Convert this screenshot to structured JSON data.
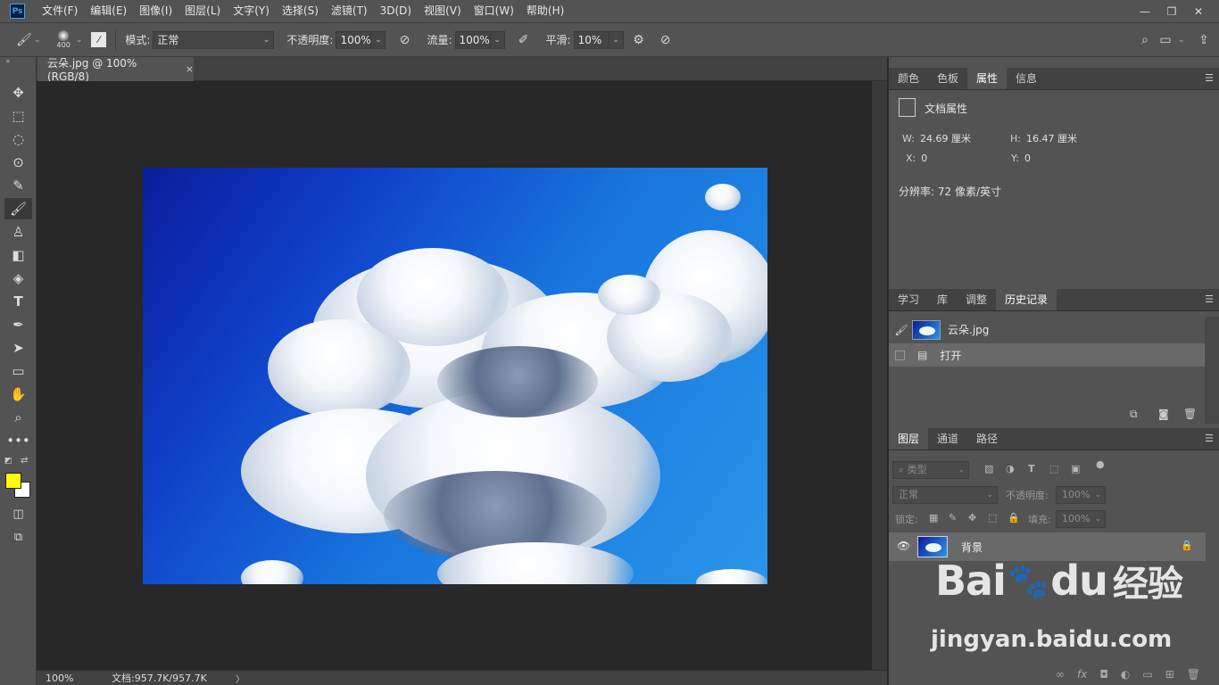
{
  "app": {
    "logo": "Ps"
  },
  "menu": [
    "文件(F)",
    "编辑(E)",
    "图像(I)",
    "图层(L)",
    "文字(Y)",
    "选择(S)",
    "滤镜(T)",
    "3D(D)",
    "视图(V)",
    "窗口(W)",
    "帮助(H)"
  ],
  "window_controls": {
    "minimize": "—",
    "restore": "❐",
    "close": "✕"
  },
  "options": {
    "brush_size": "400",
    "mode_label": "模式:",
    "mode_value": "正常",
    "opacity_label": "不透明度:",
    "opacity_value": "100%",
    "flow_label": "流量:",
    "flow_value": "100%",
    "smoothing_label": "平滑:",
    "smoothing_value": "10%"
  },
  "document": {
    "tab_title": "云朵.jpg @ 100%(RGB/8)",
    "tab_close": "×",
    "zoom": "100%",
    "doc_size": "文档:957.7K/957.7K",
    "status_arrow": "〉"
  },
  "panels": {
    "top_tabs": [
      "颜色",
      "色板",
      "属性",
      "信息"
    ],
    "top_active": 2,
    "properties": {
      "title": "文档属性",
      "w_label": "W:",
      "w_value": "24.69 厘米",
      "h_label": "H:",
      "h_value": "16.47 厘米",
      "x_label": "X:",
      "x_value": "0",
      "y_label": "Y:",
      "y_value": "0",
      "resolution": "分辨率: 72 像素/英寸"
    },
    "mid_tabs": [
      "学习",
      "库",
      "调整",
      "历史记录"
    ],
    "mid_active": 3,
    "history": {
      "snapshot_label": "云朵.jpg",
      "items": [
        "打开"
      ]
    },
    "layer_tabs": [
      "图层",
      "通道",
      "路径"
    ],
    "layer_active": 0,
    "layers": {
      "filter_placeholder": "类型",
      "blend_mode": "正常",
      "opacity_label": "不透明度:",
      "opacity_value": "100%",
      "lock_label": "锁定:",
      "fill_label": "填充:",
      "fill_value": "100%",
      "items": [
        {
          "name": "背景",
          "visible": true,
          "locked": true
        }
      ]
    }
  },
  "colors": {
    "foreground": "#ffff00",
    "background": "#ffffff"
  },
  "watermark": {
    "logo_text": "Bai",
    "logo_text2": "du",
    "logo_cn": "经验",
    "url": "jingyan.baidu.com"
  }
}
